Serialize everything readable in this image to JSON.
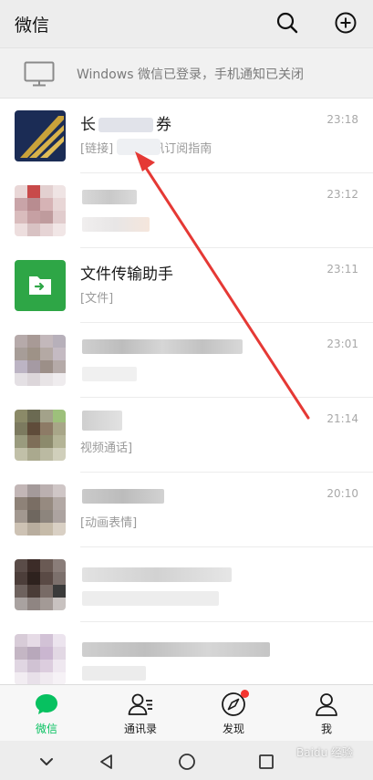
{
  "app": {
    "title": "微信"
  },
  "notice": {
    "text": "Windows 微信已登录，手机通知已关闭"
  },
  "chats": [
    {
      "name": "长",
      "name_hidden": "券",
      "preview": "[链接] 每日资讯订阅指南",
      "time": "23:18"
    },
    {
      "name": "",
      "preview": "",
      "time": "23:12"
    },
    {
      "name": "文件传输助手",
      "preview": "[文件]",
      "time": "23:11"
    },
    {
      "name": "",
      "preview": "",
      "time": "23:01"
    },
    {
      "name": "",
      "preview": "视频通话]",
      "time": "21:14"
    },
    {
      "name": "",
      "preview": "[动画表情]",
      "time": "20:10"
    },
    {
      "name": "",
      "preview": "",
      "time": ""
    },
    {
      "name": "",
      "preview": "",
      "time": ""
    }
  ],
  "tabs": [
    {
      "label": "微信",
      "icon": "chat-bubble-icon",
      "active": true
    },
    {
      "label": "通讯录",
      "icon": "contacts-icon",
      "active": false
    },
    {
      "label": "发现",
      "icon": "compass-icon",
      "active": false
    },
    {
      "label": "我",
      "icon": "person-icon",
      "active": false
    }
  ],
  "watermark": "Baidu 经验",
  "colors": {
    "accent": "#07c160",
    "badge": "#f43530",
    "arrow": "#e53935"
  }
}
